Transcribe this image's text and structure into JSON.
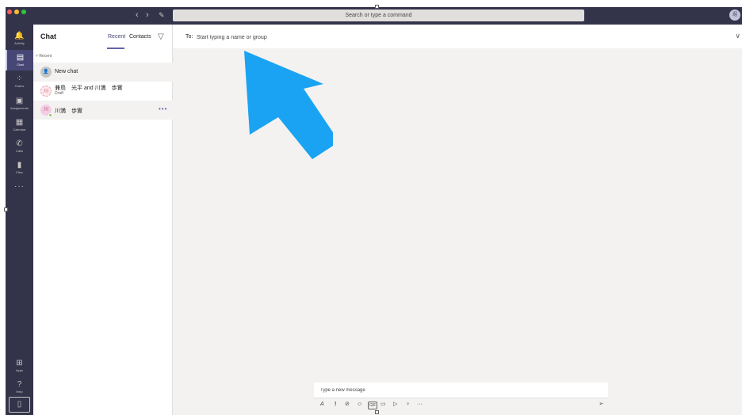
{
  "window": {
    "search_placeholder": "Search or type a command",
    "user_initials": "堀",
    "nav_back": "‹",
    "nav_forward": "›",
    "compose_icon": "✎"
  },
  "rail": {
    "items": [
      {
        "label": "Activity",
        "icon": "bell-icon",
        "glyph": "🔔"
      },
      {
        "label": "Chat",
        "icon": "chat-icon",
        "glyph": "▤"
      },
      {
        "label": "Teams",
        "icon": "teams-icon",
        "glyph": "⁘"
      },
      {
        "label": "Assignments",
        "icon": "assignments-icon",
        "glyph": "▣"
      },
      {
        "label": "Calendar",
        "icon": "calendar-icon",
        "glyph": "▦"
      },
      {
        "label": "Calls",
        "icon": "phone-icon",
        "glyph": "✆"
      },
      {
        "label": "Files",
        "icon": "files-icon",
        "glyph": "▮"
      }
    ],
    "more": "···",
    "apps_label": "Apps",
    "help_label": "Help",
    "apps_glyph": "⊞",
    "help_glyph": "?",
    "device_glyph": "▯"
  },
  "chatlist": {
    "title": "Chat",
    "tabs": {
      "recent": "Recent",
      "contacts": "Contacts"
    },
    "filter_glyph": "▽",
    "section": "Recent",
    "section_chevron": "˅",
    "items": [
      {
        "name": "New chat",
        "sub": "",
        "avatar": "👤"
      },
      {
        "name": "兼島　光平 and 川満　歩實",
        "sub": "Draft",
        "avatar": "川"
      },
      {
        "name": "川満　歩實",
        "sub": "",
        "avatar": "川"
      }
    ],
    "more_glyph": "•••"
  },
  "main": {
    "to_label": "To:",
    "to_placeholder": "Start typing a name or group",
    "to_chevron": "∨",
    "compose_placeholder": "Type a new message",
    "toolbar": [
      "A",
      "!",
      "⊘",
      "☺",
      "GIF",
      "▭",
      "▷",
      "♀",
      "···"
    ],
    "send_glyph": "➢"
  },
  "colors": {
    "rail_bg": "#33344a",
    "accent": "#6264a7",
    "annotation_arrow": "#1aa3f2"
  }
}
